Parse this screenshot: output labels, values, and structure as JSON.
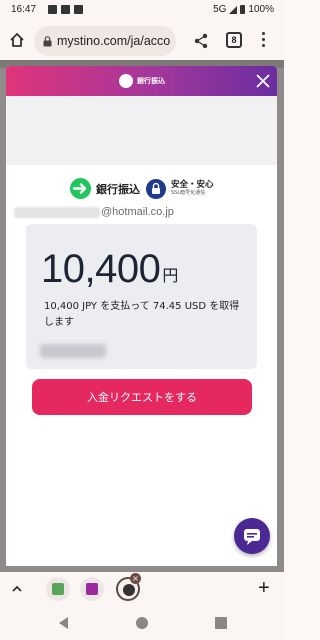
{
  "status_bar": {
    "time": "16:47",
    "network": "5G",
    "battery": "100%"
  },
  "browser": {
    "url": "mystino.com/ja/acco",
    "tab_count": "8"
  },
  "modal": {
    "header_title": "銀行振込",
    "brand_label": "銀行振込",
    "safety_title": "安全・安心",
    "safety_subtitle": "SSL暗号化通信",
    "email_domain": "@hotmail.co.jp",
    "amount": "10,400",
    "currency": "円",
    "description": "10,400 JPY を支払って 74.45 USD を取得します",
    "submit_label": "入金リクエストをする"
  },
  "colors": {
    "header_gradient_start": "#e0357a",
    "header_gradient_end": "#6b2da0",
    "cta": "#e5295f",
    "chat": "#4b2994",
    "trust_green": "#22c55e",
    "lock_blue": "#1e3a8a"
  },
  "icons": {
    "home": "home-icon",
    "share": "share-icon",
    "menu": "more-vert-icon",
    "close": "close-icon",
    "chat": "chat-icon"
  }
}
